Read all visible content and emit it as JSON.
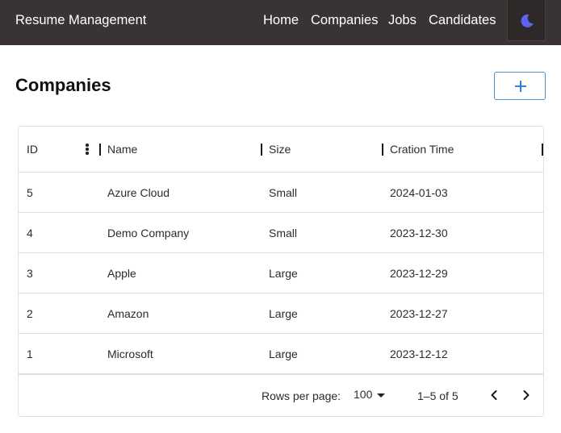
{
  "navbar": {
    "brand": "Resume Management",
    "links": [
      "Home",
      "Companies",
      "Jobs",
      "Candidates"
    ],
    "theme_toggle_icon": "moon-icon",
    "theme_icon_color": "#5b63f0"
  },
  "page": {
    "title": "Companies",
    "add_button_icon": "plus-icon"
  },
  "table": {
    "columns": [
      "ID",
      "Name",
      "Size",
      "Cration Time"
    ],
    "rows": [
      {
        "id": "5",
        "name": "Azure Cloud",
        "size": "Small",
        "created": "2024-01-03"
      },
      {
        "id": "4",
        "name": "Demo Company",
        "size": "Small",
        "created": "2023-12-30"
      },
      {
        "id": "3",
        "name": "Apple",
        "size": "Large",
        "created": "2023-12-29"
      },
      {
        "id": "2",
        "name": "Amazon",
        "size": "Large",
        "created": "2023-12-27"
      },
      {
        "id": "1",
        "name": "Microsoft",
        "size": "Large",
        "created": "2023-12-12"
      }
    ]
  },
  "pagination": {
    "rows_per_page_label": "Rows per page:",
    "rows_per_page_value": "100",
    "range": "1–5 of 5"
  },
  "colors": {
    "navbar_bg": "#393433",
    "accent": "#1976d2"
  }
}
